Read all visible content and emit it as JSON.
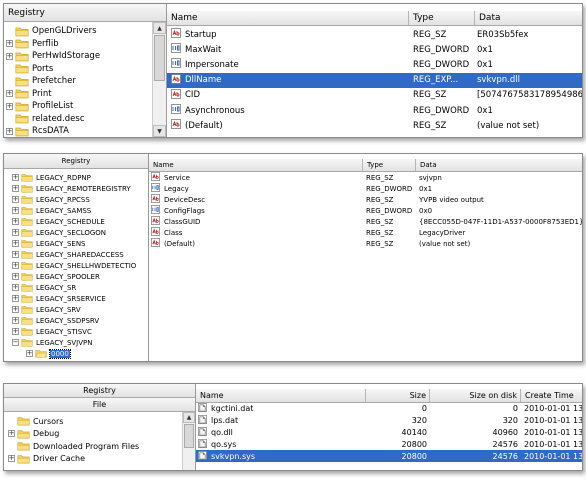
{
  "panel1": {
    "tree_header": "Registry",
    "tree_items": [
      {
        "label": "OpenGLDrivers",
        "expander": "none"
      },
      {
        "label": "Perflib",
        "expander": "+"
      },
      {
        "label": "PerHwIdStorage",
        "expander": "+"
      },
      {
        "label": "Ports",
        "expander": "none"
      },
      {
        "label": "Prefetcher",
        "expander": "none"
      },
      {
        "label": "Print",
        "expander": "+"
      },
      {
        "label": "ProfileList",
        "expander": "+"
      },
      {
        "label": "related.desc",
        "expander": "none"
      },
      {
        "label": "RcsDATA",
        "expander": "+"
      }
    ],
    "columns": {
      "name": "Name",
      "type": "Type",
      "data": "Data"
    },
    "rows": [
      {
        "name": "Startup",
        "type": "REG_SZ",
        "data": "ER03Sb5fex",
        "icon": "ab",
        "selected": false
      },
      {
        "name": "MaxWait",
        "type": "REG_DWORD",
        "data": "0x1",
        "icon": "bin",
        "selected": false
      },
      {
        "name": "Impersonate",
        "type": "REG_DWORD",
        "data": "0x1",
        "icon": "bin",
        "selected": false
      },
      {
        "name": "DllName",
        "type": "REG_EXP...",
        "data": "svkvpn.dll",
        "icon": "ab",
        "selected": true
      },
      {
        "name": "CID",
        "type": "REG_SZ",
        "data": "[5074767583178954986]",
        "icon": "ab",
        "selected": false
      },
      {
        "name": "Asynchronous",
        "type": "REG_DWORD",
        "data": "0x1",
        "icon": "bin",
        "selected": false
      },
      {
        "name": "(Default)",
        "type": "REG_SZ",
        "data": "(value not set)",
        "icon": "ab",
        "selected": false
      }
    ]
  },
  "panel2": {
    "tree_header": "Registry",
    "tree_items": [
      {
        "label": "LEGACY_RDPNP",
        "expander": "+"
      },
      {
        "label": "LEGACY_REMOTEREGISTRY",
        "expander": "+"
      },
      {
        "label": "LEGACY_RPCSS",
        "expander": "+"
      },
      {
        "label": "LEGACY_SAMSS",
        "expander": "+"
      },
      {
        "label": "LEGACY_SCHEDULE",
        "expander": "+"
      },
      {
        "label": "LEGACY_SECLOGON",
        "expander": "+"
      },
      {
        "label": "LEGACY_SENS",
        "expander": "+"
      },
      {
        "label": "LEGACY_SHAREDACCESS",
        "expander": "+"
      },
      {
        "label": "LEGACY_SHELLHWDETECTIO",
        "expander": "+"
      },
      {
        "label": "LEGACY_SPOOLER",
        "expander": "+"
      },
      {
        "label": "LEGACY_SR",
        "expander": "+"
      },
      {
        "label": "LEGACY_SRSERVICE",
        "expander": "+"
      },
      {
        "label": "LEGACY_SRV",
        "expander": "+"
      },
      {
        "label": "LEGACY_SSDPSRV",
        "expander": "+"
      },
      {
        "label": "LEGACY_STISVC",
        "expander": "+"
      },
      {
        "label": "LEGACY_SVJVPN",
        "expander": "-"
      },
      {
        "label": "0000",
        "expander": "+",
        "child": true,
        "selected": true
      }
    ],
    "columns": {
      "name": "Name",
      "type": "Type",
      "data": "Data"
    },
    "rows": [
      {
        "name": "Service",
        "type": "REG_SZ",
        "data": "svjvpn",
        "icon": "ab"
      },
      {
        "name": "Legacy",
        "type": "REG_DWORD",
        "data": "0x1",
        "icon": "bin"
      },
      {
        "name": "DeviceDesc",
        "type": "REG_SZ",
        "data": "YVPB video output",
        "icon": "ab"
      },
      {
        "name": "ConfigFlags",
        "type": "REG_DWORD",
        "data": "0x0",
        "icon": "bin"
      },
      {
        "name": "ClassGUID",
        "type": "REG_SZ",
        "data": "{8ECC055D-047F-11D1-A537-0000F8753ED1}",
        "icon": "ab"
      },
      {
        "name": "Class",
        "type": "REG_SZ",
        "data": "LegacyDriver",
        "icon": "ab"
      },
      {
        "name": "(Default)",
        "type": "REG_SZ",
        "data": "(value not set)",
        "icon": "ab"
      }
    ]
  },
  "panel3": {
    "tree_header": "Registry",
    "tree_subheader": "File",
    "tree_items": [
      {
        "label": "Cursors",
        "expander": "none"
      },
      {
        "label": "Debug",
        "expander": "+"
      },
      {
        "label": "Downloaded Program Files",
        "expander": "none"
      },
      {
        "label": "Driver Cache",
        "expander": "+"
      }
    ],
    "columns": {
      "name": "Name",
      "size": "Size",
      "size_on_disk": "Size on disk",
      "create_time": "Create Time"
    },
    "rows": [
      {
        "name": "kgctini.dat",
        "size": "0",
        "size_on_disk": "0",
        "create_time": "2010-01-01  13",
        "selected": false
      },
      {
        "name": "lps.dat",
        "size": "320",
        "size_on_disk": "320",
        "create_time": "2010-01-01  13",
        "selected": false
      },
      {
        "name": "qo.dll",
        "size": "40140",
        "size_on_disk": "40960",
        "create_time": "2010-01-01  13",
        "selected": false
      },
      {
        "name": "qo.sys",
        "size": "20800",
        "size_on_disk": "24576",
        "create_time": "2010-01-01  13",
        "selected": false
      },
      {
        "name": "svkvpn.sys",
        "size": "20800",
        "size_on_disk": "24576",
        "create_time": "2010-01-01  13",
        "selected": true
      }
    ]
  },
  "colors": {
    "selection": "#316ac5",
    "folder": "#f4d35e",
    "folder_edge": "#c9a227"
  }
}
